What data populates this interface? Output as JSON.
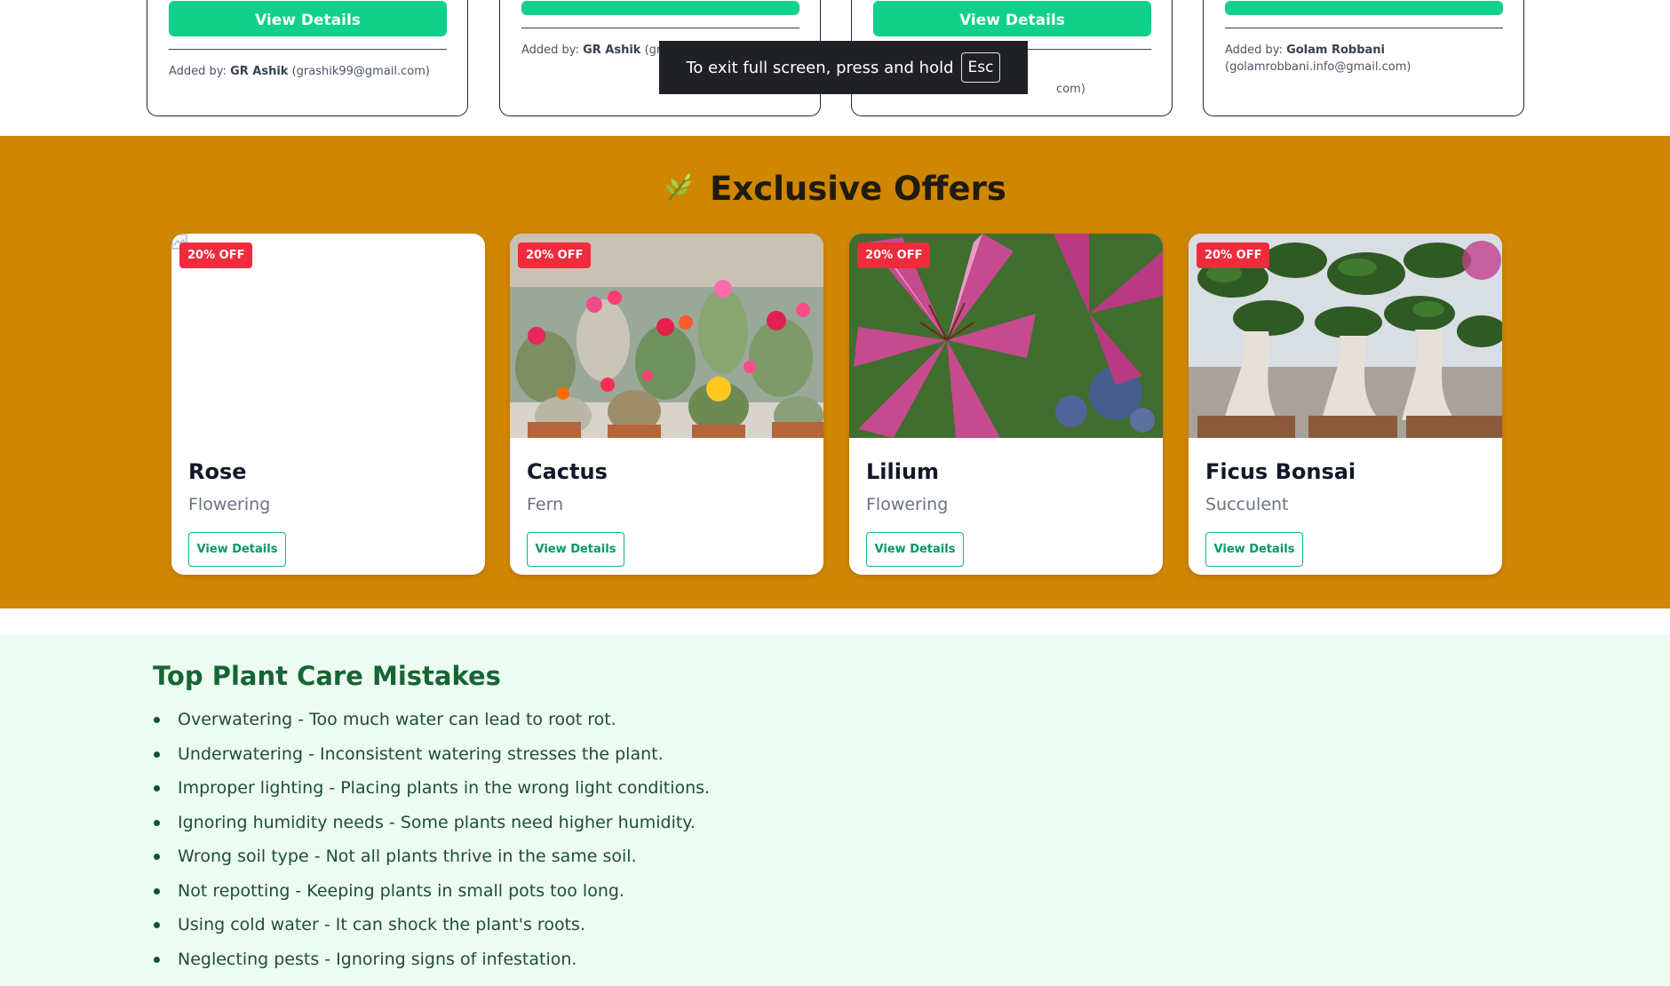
{
  "top_cards": [
    {
      "button": "View Details",
      "added_prefix": "Added by:",
      "added_name": "GR Ashik",
      "added_email": "(grashik99@gmail.com)"
    },
    {
      "button": "",
      "added_prefix": "Added by:",
      "added_name": "GR Ashik",
      "added_email": "(gra"
    },
    {
      "button": "View Details",
      "added_email_tail": "com)"
    },
    {
      "button": "",
      "added_prefix": "Added by:",
      "added_name": "Golam Robbani",
      "added_email": "(golamrobbani.info@gmail.com)"
    }
  ],
  "toast": {
    "text": "To exit full screen, press and hold",
    "key": "Esc"
  },
  "offers": {
    "title": "Exclusive Offers",
    "icon": "leaf-icon",
    "colors": {
      "section_bg": "#cf8601",
      "badge": "#ef2b3c",
      "button_accent": "#10b981"
    },
    "items": [
      {
        "badge": "20% OFF",
        "name": "Rose",
        "category": "Flowering",
        "button": "View Details",
        "image": "broken-image"
      },
      {
        "badge": "20% OFF",
        "name": "Cactus",
        "category": "Fern",
        "button": "View Details",
        "image": "cactus-photo"
      },
      {
        "badge": "20% OFF",
        "name": "Lilium",
        "category": "Flowering",
        "button": "View Details",
        "image": "lily-photo"
      },
      {
        "badge": "20% OFF",
        "name": "Ficus Bonsai",
        "category": "Succulent",
        "button": "View Details",
        "image": "bonsai-photo"
      }
    ]
  },
  "mistakes": {
    "title": "Top Plant Care Mistakes",
    "items": [
      "Overwatering - Too much water can lead to root rot.",
      "Underwatering - Inconsistent watering stresses the plant.",
      "Improper lighting - Placing plants in the wrong light conditions.",
      "Ignoring humidity needs - Some plants need higher humidity.",
      "Wrong soil type - Not all plants thrive in the same soil.",
      "Not repotting - Keeping plants in small pots too long.",
      "Using cold water - It can shock the plant's roots.",
      "Neglecting pests - Ignoring signs of infestation."
    ]
  }
}
